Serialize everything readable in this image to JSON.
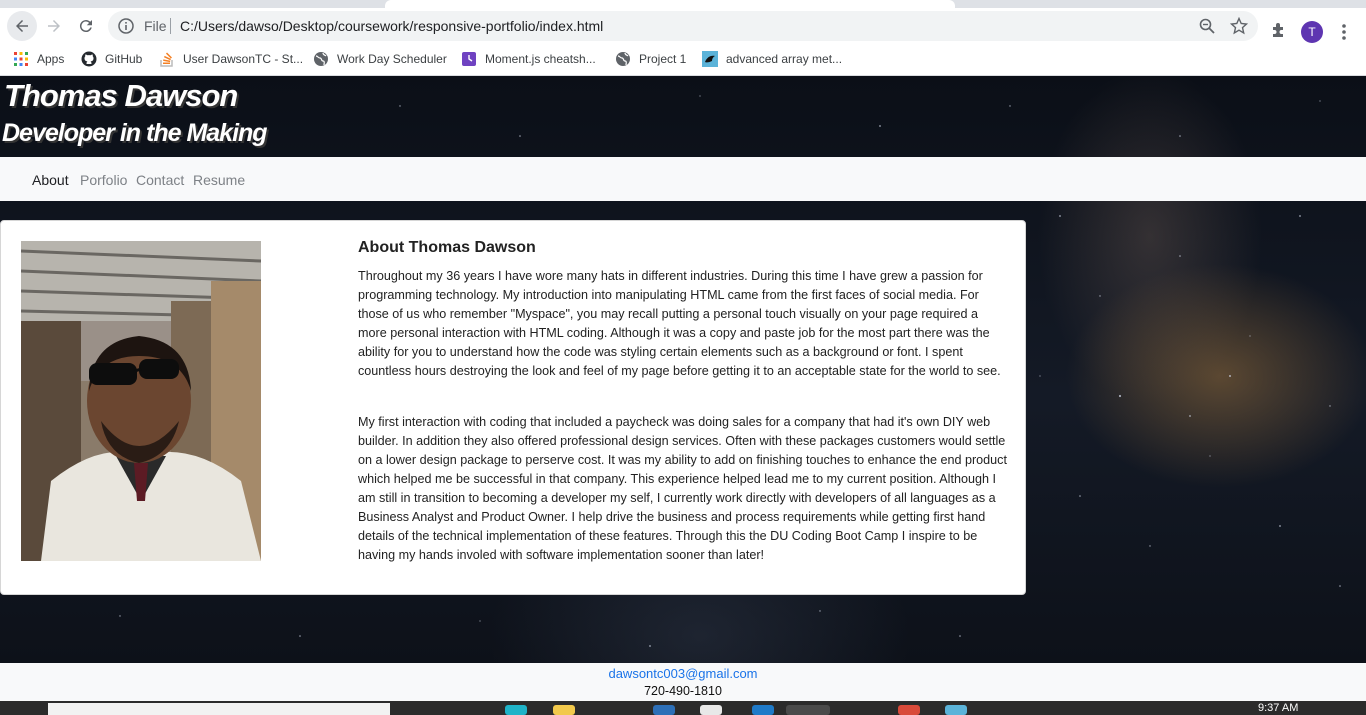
{
  "browser": {
    "file_label": "File",
    "url": "C:/Users/dawso/Desktop/coursework/responsive-portfolio/index.html",
    "profile_initial": "T",
    "bookmarks": [
      {
        "label": "Apps",
        "icon": "apps-grid-icon"
      },
      {
        "label": "GitHub",
        "icon": "github-icon"
      },
      {
        "label": "User DawsonTC - St...",
        "icon": "stackoverflow-icon"
      },
      {
        "label": "Work Day Scheduler",
        "icon": "globe-icon"
      },
      {
        "label": "Moment.js cheatsh...",
        "icon": "moment-icon"
      },
      {
        "label": "Project 1",
        "icon": "globe-icon"
      },
      {
        "label": "advanced array met...",
        "icon": "bird-icon"
      }
    ]
  },
  "header": {
    "name": "Thomas Dawson",
    "tagline": "Developer in the Making"
  },
  "nav": {
    "items": [
      "About",
      "Porfolio",
      "Contact",
      "Resume"
    ],
    "active": "About"
  },
  "about": {
    "title": "About Thomas Dawson",
    "paragraphs": [
      "Throughout my 36 years I have wore many hats in different industries. During this time I have grew a passion for programming technology. My introduction into manipulating HTML came from the first faces of social media. For those of us who remember \"Myspace\", you may recall putting a personal touch visually on your page required a more personal interaction with HTML coding. Although it was a copy and paste job for the most part there was the ability for you to understand how the code was styling certain elements such as a background or font. I spent countless hours destroying the look and feel of my page before getting it to an acceptable state for the world to see.",
      "My first interaction with coding that included a paycheck was doing sales for a company that had it's own DIY web builder. In addition they also offered professional design services. Often with these packages customers would settle on a lower design package to perserve cost. It was my ability to add on finishing touches to enhance the end product which helped me be successful in that company. This experience helped lead me to my current position. Although I am still in transition to becoming a developer my self, I currently work directly with developers of all languages as a Business Analyst and Product Owner. I help drive the business and process requirements while getting first hand details of the technical implementation of these features. Through this the DU Coding Boot Camp I inspire to be having my hands involed with software implementation sooner than later!"
    ]
  },
  "footer": {
    "email": "dawsontc003@gmail.com",
    "phone": "720-490-1810"
  },
  "taskbar": {
    "clock": "9:37 AM"
  }
}
